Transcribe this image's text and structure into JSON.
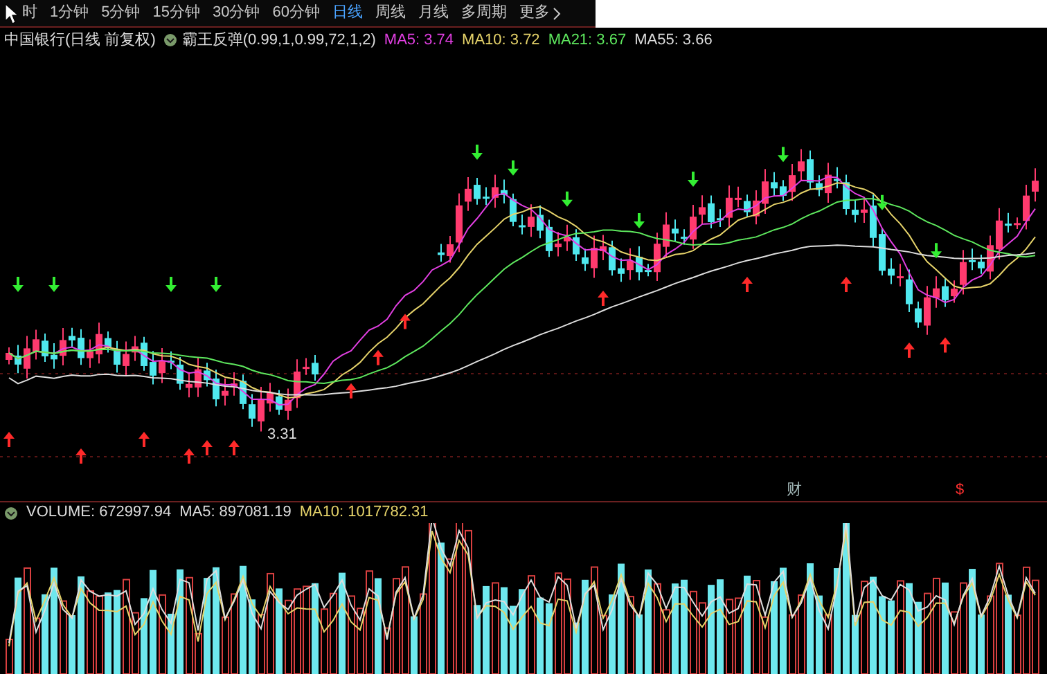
{
  "toolbar": {
    "periods": [
      {
        "label": "时",
        "selected": false
      },
      {
        "label": "1分钟",
        "selected": false
      },
      {
        "label": "5分钟",
        "selected": false
      },
      {
        "label": "15分钟",
        "selected": false
      },
      {
        "label": "30分钟",
        "selected": false
      },
      {
        "label": "60分钟",
        "selected": false
      },
      {
        "label": "日线",
        "selected": true
      },
      {
        "label": "周线",
        "selected": false
      },
      {
        "label": "月线",
        "selected": false
      },
      {
        "label": "多周期",
        "selected": false
      },
      {
        "label": "更多",
        "selected": false
      }
    ]
  },
  "legend": {
    "stock": "中国银行(日线 前复权)",
    "indicator": "霸王反弹(0.99,1,0.99,72,1,2)",
    "averages": [
      {
        "label": "MA5: 3.74",
        "color": "#e23fe2"
      },
      {
        "label": "MA10: 3.72",
        "color": "#e6d36a"
      },
      {
        "label": "MA21: 3.67",
        "color": "#5ee85e"
      },
      {
        "label": "MA55: 3.66",
        "color": "#dddddd"
      }
    ]
  },
  "chart": {
    "low_label": "3.31",
    "event_markers": [
      {
        "text": "财",
        "color": "#9fb4b4"
      },
      {
        "text": "$",
        "color": "#ff3030"
      }
    ]
  },
  "volume": {
    "items": [
      {
        "label": "VOLUME: 672997.94",
        "color": "#dddddd"
      },
      {
        "label": "MA5: 897081.19",
        "color": "#dddddd"
      },
      {
        "label": "MA10: 1017782.31",
        "color": "#e6d36a"
      }
    ]
  }
}
